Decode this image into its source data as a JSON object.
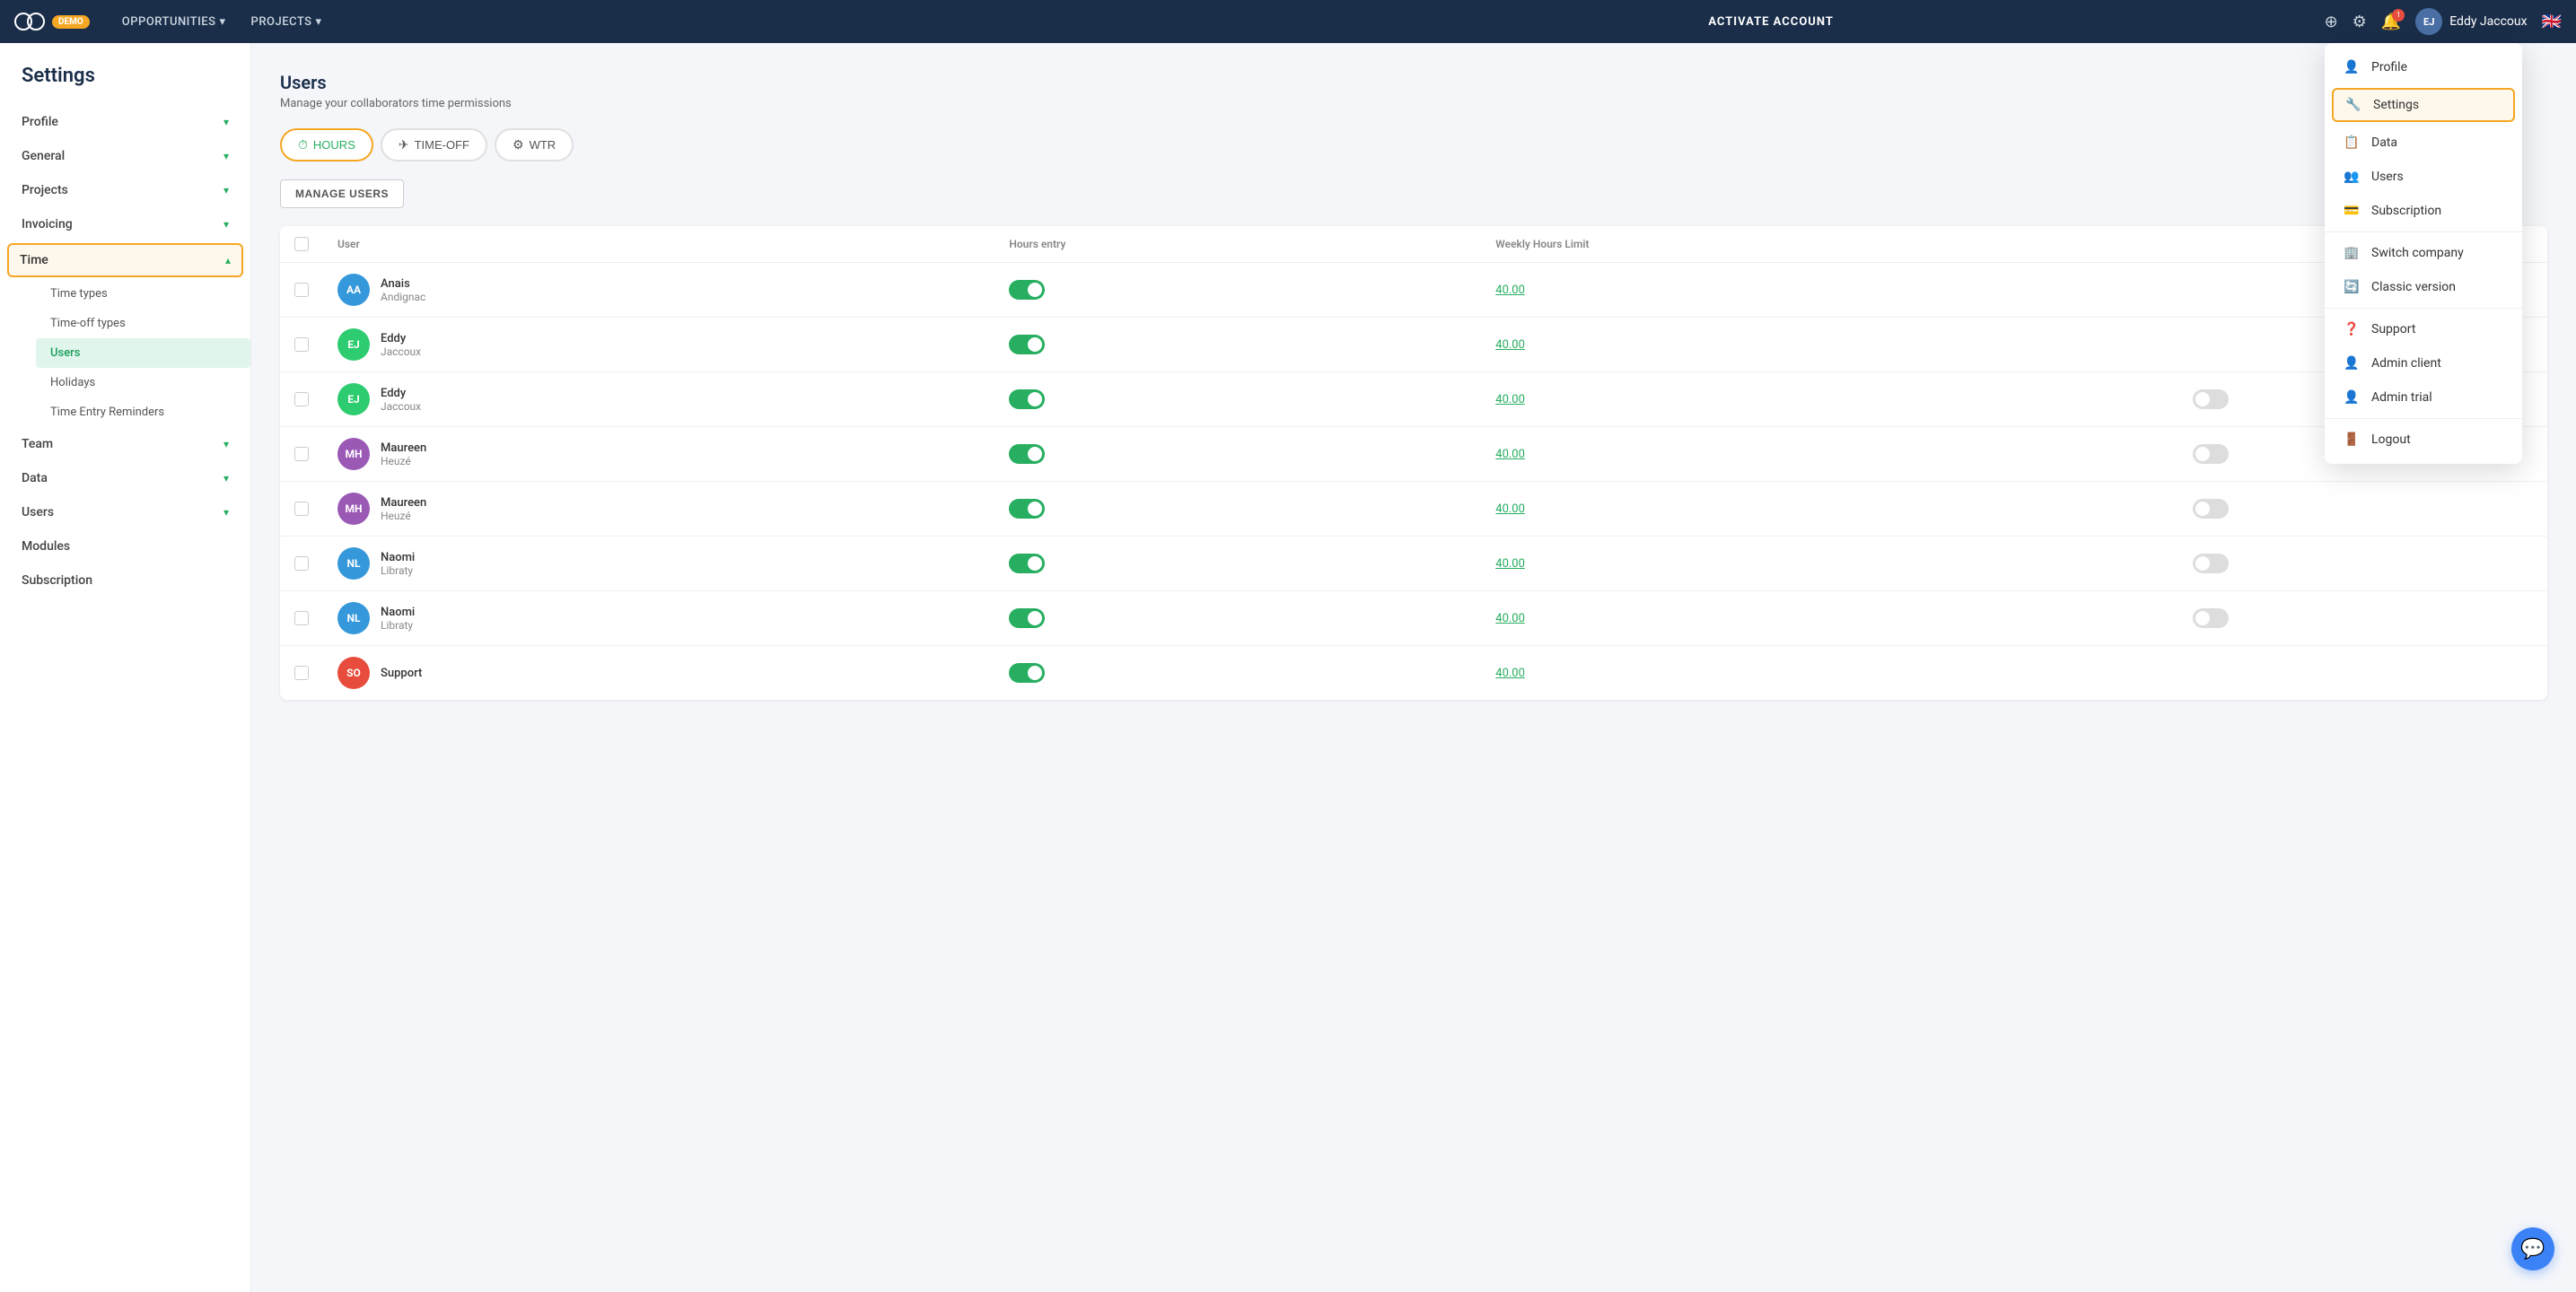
{
  "app": {
    "name": "OOTI",
    "demo_badge": "DEMO"
  },
  "topnav": {
    "links": [
      {
        "label": "OPPORTUNITIES",
        "has_dropdown": true
      },
      {
        "label": "PROJECTS",
        "has_dropdown": true
      }
    ],
    "center_action": "ACTIVATE ACCOUNT",
    "user_name": "Eddy Jaccoux",
    "user_initials": "EJ"
  },
  "page_title": "Settings",
  "sidebar": {
    "items": [
      {
        "label": "Profile",
        "active": false,
        "has_sub": false
      },
      {
        "label": "General",
        "active": false,
        "has_sub": false
      },
      {
        "label": "Projects",
        "active": false,
        "has_sub": false
      },
      {
        "label": "Invoicing",
        "active": false,
        "has_sub": false
      },
      {
        "label": "Time",
        "active": true,
        "has_sub": true,
        "sub_items": [
          {
            "label": "Time types",
            "active": false
          },
          {
            "label": "Time-off types",
            "active": false
          },
          {
            "label": "Users",
            "active": true
          },
          {
            "label": "Holidays",
            "active": false
          },
          {
            "label": "Time Entry Reminders",
            "active": false
          }
        ]
      },
      {
        "label": "Team",
        "active": false,
        "has_sub": false
      },
      {
        "label": "Data",
        "active": false,
        "has_sub": false
      },
      {
        "label": "Users",
        "active": false,
        "has_sub": false
      },
      {
        "label": "Modules",
        "active": false,
        "has_sub": false
      },
      {
        "label": "Subscription",
        "active": false,
        "has_sub": false
      }
    ]
  },
  "main": {
    "title": "Users",
    "subtitle": "Manage your collaborators time permissions",
    "tabs": [
      {
        "label": "HOURS",
        "icon": "⏱",
        "active": true
      },
      {
        "label": "TIME-OFF",
        "icon": "✈",
        "active": false
      },
      {
        "label": "WTR",
        "icon": "⚙",
        "active": false
      }
    ],
    "manage_btn": "MANAGE USERS",
    "table": {
      "columns": [
        "",
        "User",
        "Hours entry",
        "Weekly Hours Limit",
        ""
      ],
      "rows": [
        {
          "initials": "AA",
          "avatar_class": "avatar-aa",
          "first_name": "Anais",
          "last_name": "Andignac",
          "hours_entry": true,
          "weekly_limit": "40.00",
          "show_toggle2": false
        },
        {
          "initials": "EJ",
          "avatar_class": "avatar-ej",
          "first_name": "Eddy",
          "last_name": "Jaccoux",
          "hours_entry": true,
          "weekly_limit": "40.00",
          "show_toggle2": false
        },
        {
          "initials": "EJ",
          "avatar_class": "avatar-ej",
          "first_name": "Eddy",
          "last_name": "Jaccoux",
          "hours_entry": true,
          "weekly_limit": "40.00",
          "show_toggle2": true
        },
        {
          "initials": "MH",
          "avatar_class": "avatar-mh",
          "first_name": "Maureen",
          "last_name": "Heuzé",
          "hours_entry": true,
          "weekly_limit": "40.00",
          "show_toggle2": true
        },
        {
          "initials": "MH",
          "avatar_class": "avatar-mh",
          "first_name": "Maureen",
          "last_name": "Heuzé",
          "hours_entry": true,
          "weekly_limit": "40.00",
          "show_toggle2": true
        },
        {
          "initials": "NL",
          "avatar_class": "avatar-nl",
          "first_name": "Naomi",
          "last_name": "Libraty",
          "hours_entry": true,
          "weekly_limit": "40.00",
          "show_toggle2": true
        },
        {
          "initials": "NL",
          "avatar_class": "avatar-nl",
          "first_name": "Naomi",
          "last_name": "Libraty",
          "hours_entry": true,
          "weekly_limit": "40.00",
          "show_toggle2": true
        },
        {
          "initials": "SO",
          "avatar_class": "avatar-so",
          "first_name": "Support",
          "last_name": "",
          "hours_entry": true,
          "weekly_limit": "40.00",
          "show_toggle2": false
        }
      ]
    }
  },
  "dropdown": {
    "items": [
      {
        "label": "Profile",
        "icon": "👤",
        "active": false
      },
      {
        "label": "Settings",
        "icon": "🔧",
        "active": true
      },
      {
        "label": "Data",
        "icon": "📋",
        "active": false
      },
      {
        "label": "Users",
        "icon": "👥",
        "active": false
      },
      {
        "label": "Subscription",
        "icon": "💳",
        "active": false
      },
      {
        "label": "Switch company",
        "icon": "🏢",
        "active": false
      },
      {
        "label": "Classic version",
        "icon": "🔄",
        "active": false
      },
      {
        "label": "Support",
        "icon": "❓",
        "active": false
      },
      {
        "label": "Admin client",
        "icon": "👤",
        "active": false
      },
      {
        "label": "Admin trial",
        "icon": "👤",
        "active": false
      },
      {
        "label": "Logout",
        "icon": "🚪",
        "active": false
      }
    ]
  }
}
